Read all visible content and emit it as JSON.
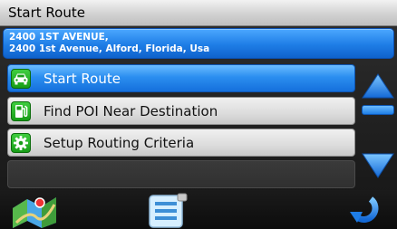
{
  "header": {
    "title": "Start Route"
  },
  "address": {
    "line1": "2400 1ST AVENUE,",
    "line2": "2400 1st Avenue, Alford, Florida, Usa"
  },
  "menu": {
    "items": [
      {
        "label": "Start Route",
        "icon": "car-icon",
        "selected": true
      },
      {
        "label": "Find POI Near Destination",
        "icon": "fuel-pump-icon",
        "selected": false
      },
      {
        "label": "Setup Routing Criteria",
        "icon": "gear-icon",
        "selected": false
      },
      {
        "label": "",
        "icon": "",
        "selected": false
      }
    ]
  },
  "scroll": {
    "up_icon": "scroll-up-arrow-icon",
    "down_icon": "scroll-down-arrow-icon"
  },
  "bottombar": {
    "map_icon": "map-icon",
    "list_icon": "list-menu-icon",
    "back_icon": "back-arrow-icon"
  },
  "colors": {
    "selection_blue": "#1e7de6",
    "icon_green": "#179d17",
    "titlebar_gray": "#d2d2d2"
  }
}
